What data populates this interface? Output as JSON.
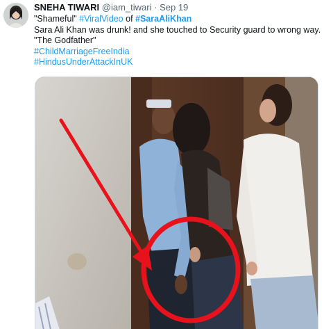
{
  "tweet": {
    "author_name": "SNEHA TIWARI",
    "handle": "@iam_tiwari",
    "separator": "·",
    "date": "Sep 19",
    "text": {
      "quote_open": "\"Shameful\" ",
      "hashtag_viral": "#ViralVideo",
      "of_word": " of ",
      "hashtag_sara": "#SaraAliKhan",
      "line2": "Sara Ali Khan was drunk! and she touched to Security guard to wrong way.",
      "line3": "\"The Godfather\"",
      "hashtag_child": "#ChildMarriageFreeIndia",
      "hashtag_hindus": "#HindusUnderAttackInUK"
    }
  },
  "colors": {
    "link": "#1d9bf0",
    "annotation_red": "#e8121c",
    "secondary_text": "#536471"
  },
  "icons": {
    "avatar": "profile-photo",
    "arrow": "red-arrow-annotation",
    "circle": "red-circle-annotation"
  }
}
